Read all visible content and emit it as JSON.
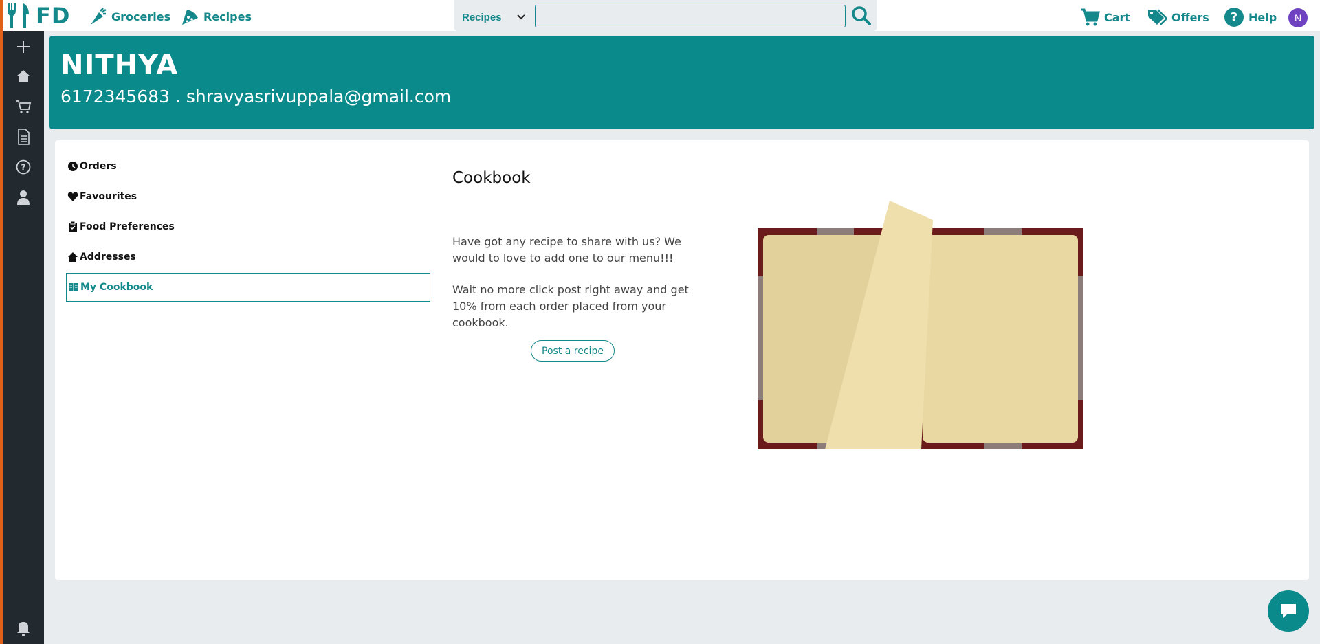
{
  "app": {
    "logo_text": "FD"
  },
  "nav": {
    "groceries": "Groceries",
    "recipes": "Recipes"
  },
  "search": {
    "category": "Recipes",
    "value": "",
    "placeholder": ""
  },
  "right_nav": {
    "cart": "Cart",
    "offers": "Offers",
    "help": "Help"
  },
  "user": {
    "initial": "N",
    "name": "NITHYA",
    "contact": "6172345683 . shravyasrivuppala@gmail.com"
  },
  "menu": [
    {
      "label": "Orders",
      "icon": "clock-icon",
      "active": false
    },
    {
      "label": "Favourites",
      "icon": "heart-icon",
      "active": false
    },
    {
      "label": "Food Preferences",
      "icon": "clipboard-icon",
      "active": false
    },
    {
      "label": "Addresses",
      "icon": "home-icon",
      "active": false
    },
    {
      "label": "My Cookbook",
      "icon": "book-icon",
      "active": true
    }
  ],
  "cookbook": {
    "title": "Cookbook",
    "paragraph1": "Have got any recipe to share with us? We would to love to add one to our menu!!!",
    "paragraph2": "Wait no more click post right away and get 10% from each order placed from your cookbook.",
    "post_button": "Post a recipe"
  },
  "sidebar_icons": [
    "plus-icon",
    "home-icon",
    "cart-icon",
    "document-icon",
    "help-icon",
    "user-icon",
    "bell-icon"
  ],
  "colors": {
    "accent": "#14888a",
    "header": "#0b8a8c",
    "sidebar": "#222a30",
    "avatar": "#6f42c1"
  }
}
